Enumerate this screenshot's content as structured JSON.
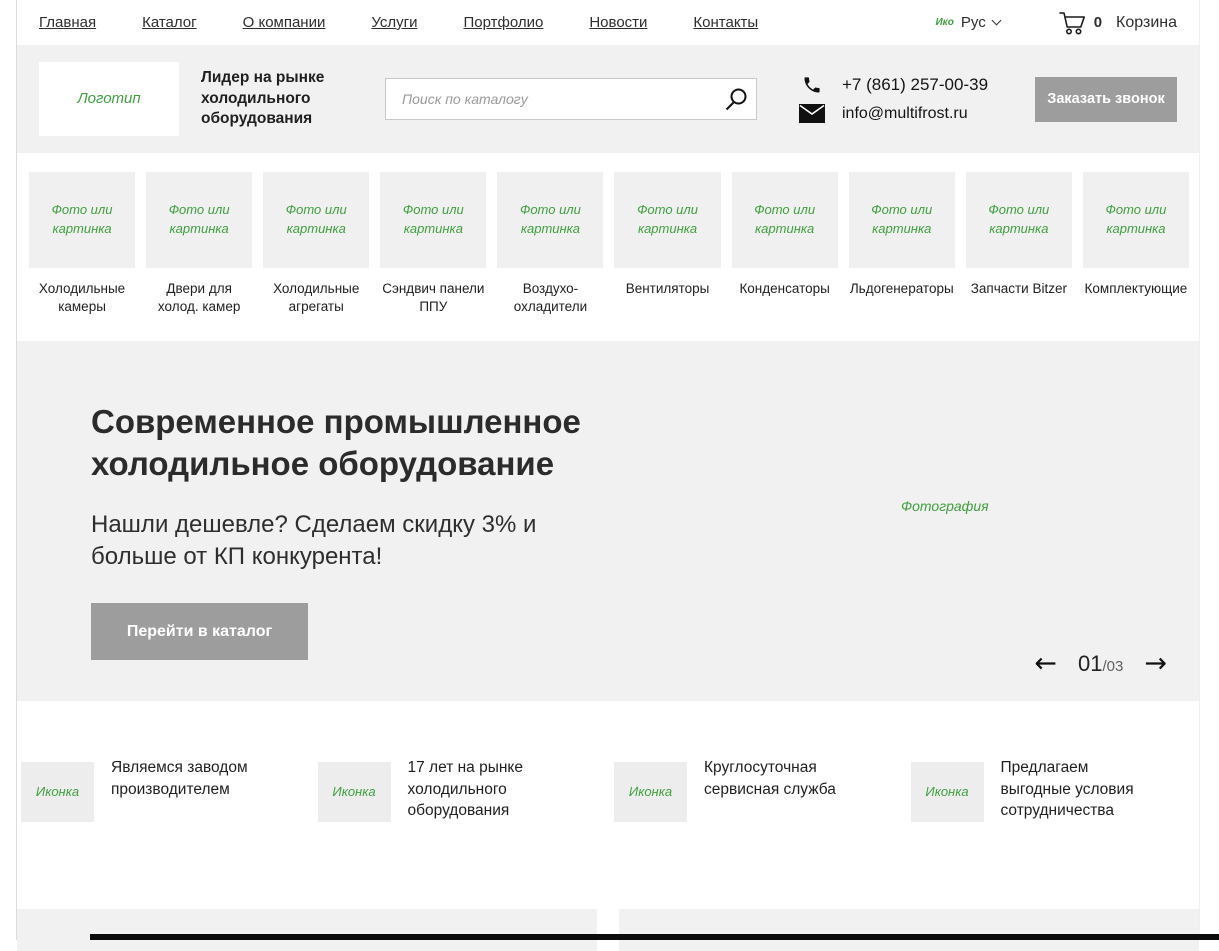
{
  "colors": {
    "accent_green": "#3fa03f",
    "button_gray": "#9d9d9d",
    "section_gray": "#f1f1f1"
  },
  "topnav": {
    "links": [
      "Главная",
      "Каталог",
      "О компании",
      "Услуги",
      "Портфолио",
      "Новости",
      "Контакты"
    ],
    "lang_icon_placeholder": "Ико",
    "lang_label": "Рус",
    "cart_count": "0",
    "cart_label": "Корзина"
  },
  "header": {
    "logo_placeholder": "Логотип",
    "tagline": "Лидер на рынке холодильного оборудования",
    "search_placeholder": "Поиск по каталогу",
    "phone": "+7 (861) 257-00-39",
    "email": "info@multifrost.ru",
    "callback_button": "Заказать звонок"
  },
  "categories": {
    "photo_placeholder": "Фото или картинка",
    "items": [
      "Холодильные камеры",
      "Двери для холод. камер",
      "Холодильные агрегаты",
      "Сэндвич панели ППУ",
      "Воздухо-охладители",
      "Вентиляторы",
      "Конденсаторы",
      "Льдогенераторы",
      "Запчасти Bitzer",
      "Комплектующие"
    ]
  },
  "hero": {
    "title": "Современное промышленное холодильное оборудование",
    "subtitle": "Нашли дешевле? Сделаем скидку 3% и больше от КП конкурента!",
    "button": "Перейти в каталог",
    "photo_placeholder": "Фотография",
    "slide_current": "01",
    "slide_total": "/03"
  },
  "features": {
    "icon_placeholder": "Иконка",
    "items": [
      "Являемся заводом производителем",
      "17 лет на рынке холодильного оборудования",
      "Круглосуточная сервисная служба",
      "Предлагаем выгодные условия сотрудничества"
    ]
  }
}
